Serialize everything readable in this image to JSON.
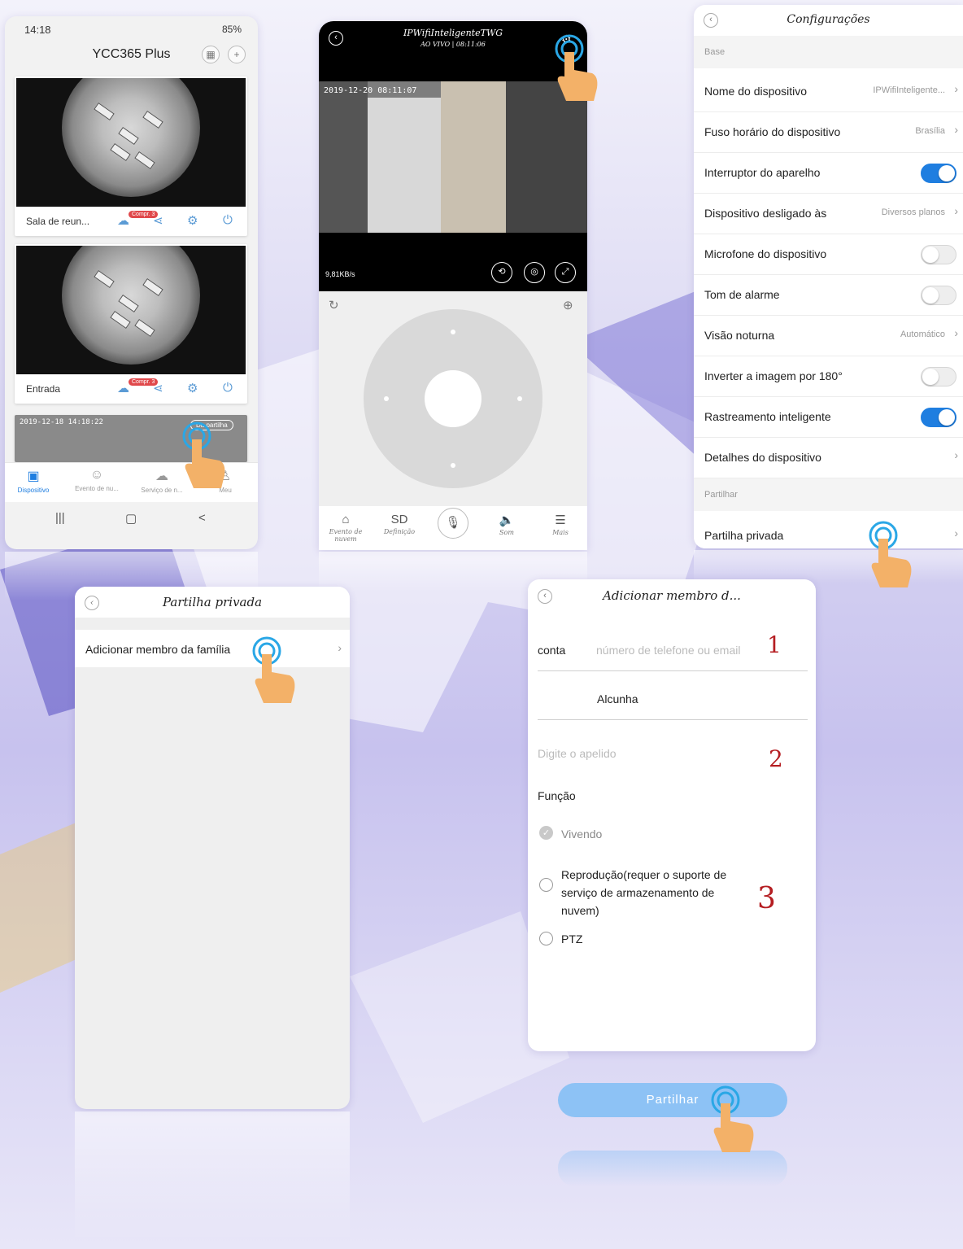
{
  "colors": {
    "accent": "#1f7ee0",
    "badge": "#e0484b",
    "annotation": "#b51e22",
    "share_button": "#8dc2f5"
  },
  "phone1": {
    "status_time": "14:18",
    "status_battery": "85%",
    "title": "YCC365 Plus",
    "grid_icon": "grid-icon",
    "add_icon": "plus-icon",
    "cards": [
      {
        "name": "Sala de reun...",
        "badge": "Compr. 3"
      },
      {
        "name": "Entrada",
        "badge": "Compr. 3"
      }
    ],
    "third_card_timestamp": "2019-12-18 14:18:22",
    "third_card_badge": "Da partilha",
    "tabs": [
      "Dispositivo",
      "Evento de nu...",
      "Serviço de n...",
      "Meu"
    ],
    "nav": [
      "|||",
      "▢",
      "<"
    ]
  },
  "phone2": {
    "title": "IPWifiInteligenteTWG",
    "subtitle": "AO VIVO | 08:11:06",
    "video_timestamp": "2019-12-20 08:11:07",
    "speed": "9,81KB/s",
    "bottom": [
      {
        "icon": "cloud-event-icon",
        "label": "Evento de nuvem",
        "glyph": "⌂"
      },
      {
        "icon": "sd-icon",
        "label": "Definição",
        "glyph": "SD"
      },
      {
        "icon": "microphone-icon",
        "label": "",
        "glyph": "🎙"
      },
      {
        "icon": "speaker-icon",
        "label": "Som",
        "glyph": "🔈"
      },
      {
        "icon": "menu-icon",
        "label": "Mais",
        "glyph": "☰"
      }
    ]
  },
  "settings": {
    "title": "Configurações",
    "section_base": "Base",
    "rows": [
      {
        "label": "Nome do dispositivo",
        "value": "IPWifiInteligente...",
        "type": "value"
      },
      {
        "label": "Fuso horário do dispositivo",
        "value": "Brasília",
        "type": "value"
      },
      {
        "label": "Interruptor do aparelho",
        "on": true,
        "type": "toggle"
      },
      {
        "label": "Dispositivo desligado às",
        "value": "Diversos planos",
        "type": "value"
      },
      {
        "label": "Microfone do dispositivo",
        "on": false,
        "type": "toggle"
      },
      {
        "label": "Tom de alarme",
        "on": false,
        "type": "toggle"
      },
      {
        "label": "Visão noturna",
        "value": "Automático",
        "type": "value"
      },
      {
        "label": "Inverter a imagem por 180°",
        "on": false,
        "type": "toggle"
      },
      {
        "label": "Rastreamento inteligente",
        "on": true,
        "type": "toggle"
      },
      {
        "label": "Detalhes do dispositivo",
        "value": "",
        "type": "value"
      }
    ],
    "section_share": "Partilhar",
    "share_row": "Partilha privada"
  },
  "private_share": {
    "title": "Partilha privada",
    "row": "Adicionar membro da família"
  },
  "add_member": {
    "title": "Adicionar membro d...",
    "account_label": "conta",
    "account_placeholder": "número de telefone ou email",
    "nickname_label": "Alcunha",
    "nickname_placeholder": "Digite o apelido",
    "role_label": "Função",
    "roles": [
      {
        "label": "Vivendo",
        "checked": true
      },
      {
        "label": "Reprodução(requer o suporte de serviço de armazenamento de nuvem)",
        "checked": false
      },
      {
        "label": "PTZ",
        "checked": false
      }
    ],
    "step_numbers": [
      "1",
      "2",
      "3"
    ],
    "share_button": "Partilhar"
  }
}
